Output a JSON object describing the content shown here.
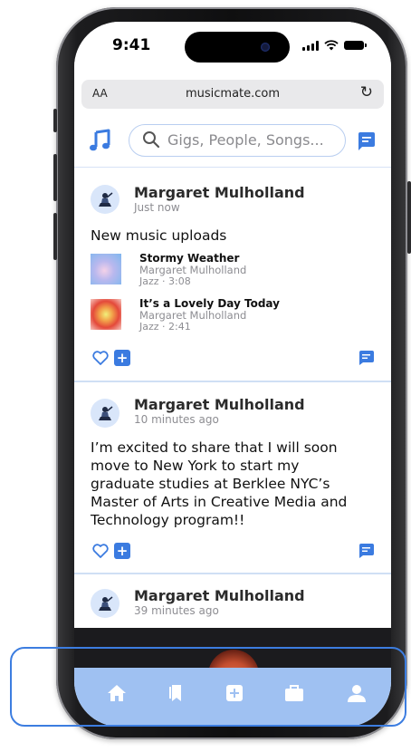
{
  "status_bar": {
    "time": "9:41"
  },
  "browser": {
    "text_size_label": "AA",
    "url": "musicmate.com",
    "reload_icon": "reload-icon"
  },
  "header": {
    "search_placeholder": "Gigs, People, Songs...",
    "logo_icon": "music-note-icon",
    "messages_icon": "message-icon"
  },
  "posts": [
    {
      "author": "Margaret Mulholland",
      "time": "Just now",
      "text": "New music uploads",
      "tracks": [
        {
          "title": "Stormy Weather",
          "artist": "Margaret Mulholland",
          "meta": "Jazz · 3:08"
        },
        {
          "title": "It’s a Lovely Day Today",
          "artist": "Margaret Mulholland",
          "meta": "Jazz · 2:41"
        }
      ]
    },
    {
      "author": "Margaret Mulholland",
      "time": "10 minutes ago",
      "text_lines": [
        "I’m excited to share that I will soon",
        "move to New York to start my",
        "graduate studies at Berklee NYC’s",
        "Master of Arts in Creative Media and",
        "Technology program!!"
      ]
    },
    {
      "author": "Margaret Mulholland",
      "time": "39 minutes ago"
    }
  ],
  "tabbar": {
    "items": [
      "home-icon",
      "bookmark-icon",
      "add-icon",
      "briefcase-icon",
      "profile-icon"
    ]
  },
  "colors": {
    "accent": "#3b7be0",
    "tabbar": "#9fc1f2",
    "highlight": "#3c7de0"
  }
}
